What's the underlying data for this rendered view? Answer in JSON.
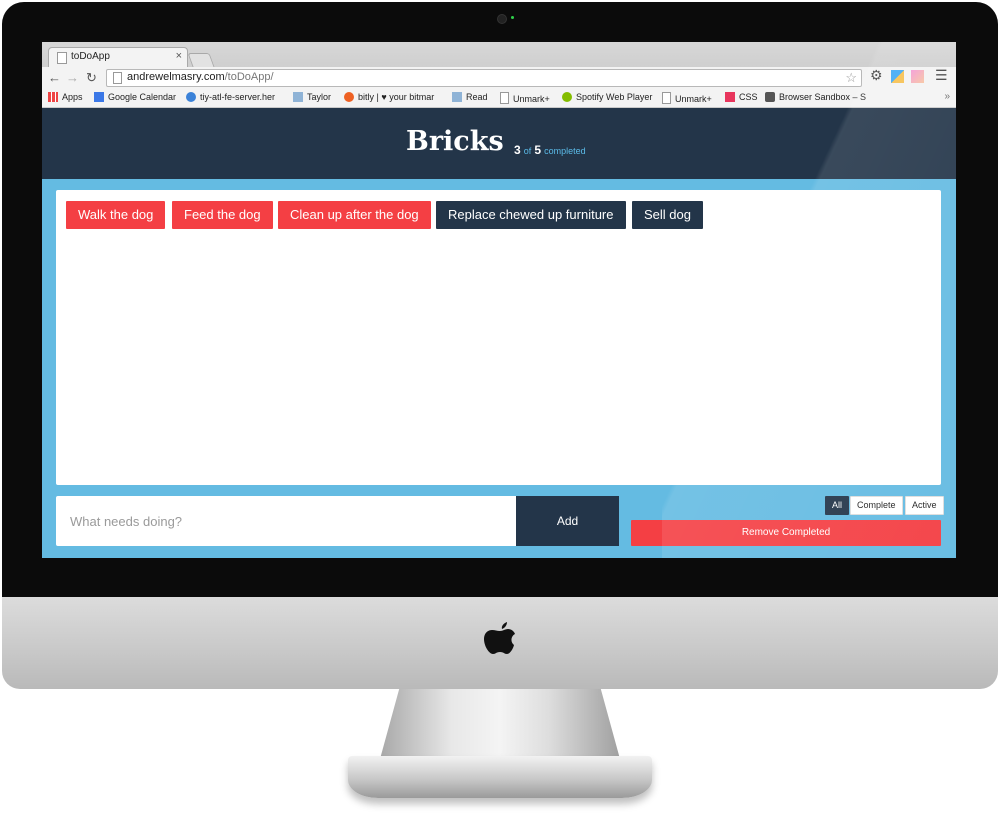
{
  "browser": {
    "tab_title": "toDoApp",
    "url_domain": "andrewelmasry.com",
    "url_path": "/toDoApp/",
    "bookmarks": [
      "Apps",
      "Google Calendar",
      "tiy-atl-fe-server.her",
      "Taylor",
      "bitly | ♥ your bitmar",
      "Read",
      "Unmark+",
      "Spotify Web Player",
      "Unmark+",
      "CSS",
      "Browser Sandbox – S"
    ],
    "bookmarks_more": "»"
  },
  "app": {
    "title": "Bricks",
    "count_done": "3",
    "count_of": "of",
    "count_total": "5",
    "count_word": "completed",
    "colors": {
      "header": "#233549",
      "body": "#64bbe2",
      "incomplete": "#f43f44",
      "complete": "#233549"
    },
    "bricks": [
      {
        "label": "Walk the dog",
        "state": "incomplete"
      },
      {
        "label": "Feed the dog",
        "state": "incomplete"
      },
      {
        "label": "Clean up after the dog",
        "state": "incomplete"
      },
      {
        "label": "Replace chewed up furniture",
        "state": "complete"
      },
      {
        "label": "Sell dog",
        "state": "complete"
      }
    ],
    "input_placeholder": "What needs doing?",
    "add_label": "Add",
    "filters": [
      "All",
      "Complete",
      "Active"
    ],
    "active_filter": "All",
    "remove_label": "Remove Completed"
  }
}
